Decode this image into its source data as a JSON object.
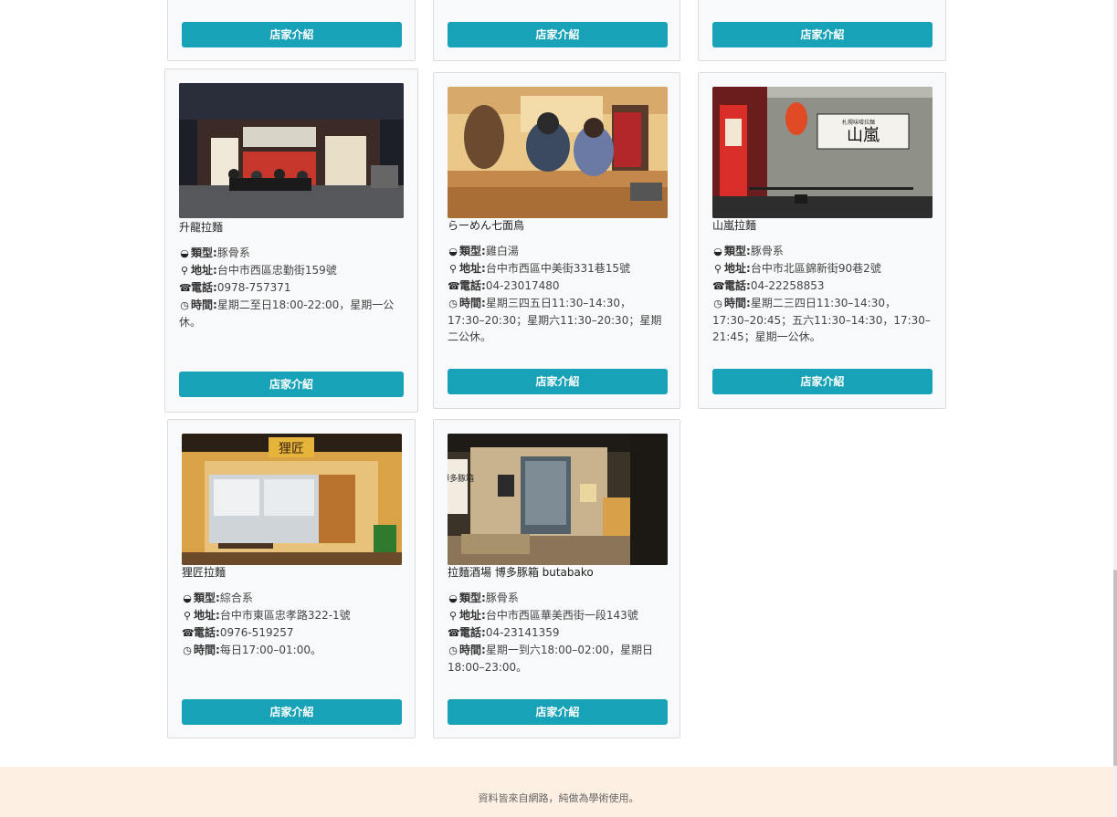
{
  "button_label": "店家介紹",
  "labels": {
    "type": "類型:",
    "address": "地址:",
    "phone": "電話:",
    "hours": "時間:"
  },
  "icons": {
    "type": "bowl-icon",
    "address": "map-marker-icon",
    "phone": "phone-icon",
    "hours": "clock-icon"
  },
  "shops": [
    {
      "name": "升龍拉麵",
      "type": "豚骨系",
      "address": "台中市西區忠勤街159號",
      "phone": "0978-757371",
      "hours": "星期二至日18:00-22:00，星期一公休。"
    },
    {
      "name": "らーめん七面鳥",
      "type": "雞白湯",
      "address": "台中市西區中美街331巷15號",
      "phone": "04-23017480",
      "hours": "星期三四五日11:30–14:30，17:30–20:30；星期六11:30–20:30；星期二公休。"
    },
    {
      "name": "山嵐拉麵",
      "type": "豚骨系",
      "address": "台中市北區錦新街90巷2號",
      "phone": "04-22258853",
      "hours": "星期二三四日11:30–14:30，17:30–20:45；五六11:30–14:30，17:30–21:45；星期一公休。"
    },
    {
      "name": "狸匠拉麵",
      "type": "綜合系",
      "address": "台中市東區忠孝路322-1號",
      "phone": "0976-519257",
      "hours": "每日17:00–01:00。"
    },
    {
      "name": "拉麵酒場 博多豚箱 butabako",
      "type": "豚骨系",
      "address": "台中市西區華美西街一段143號",
      "phone": "04-23141359",
      "hours": "星期一到六18:00–02:00，星期日18:00–23:00。"
    }
  ],
  "photo_signs": {
    "yamaarashi": "山嵐",
    "yamaarashi_small": "札幌味噌拉麵",
    "tanukisho": "狸匠",
    "hakata": "博多豚箱"
  },
  "footer": {
    "text": "資料皆來自網路，純做為學術使用。"
  }
}
